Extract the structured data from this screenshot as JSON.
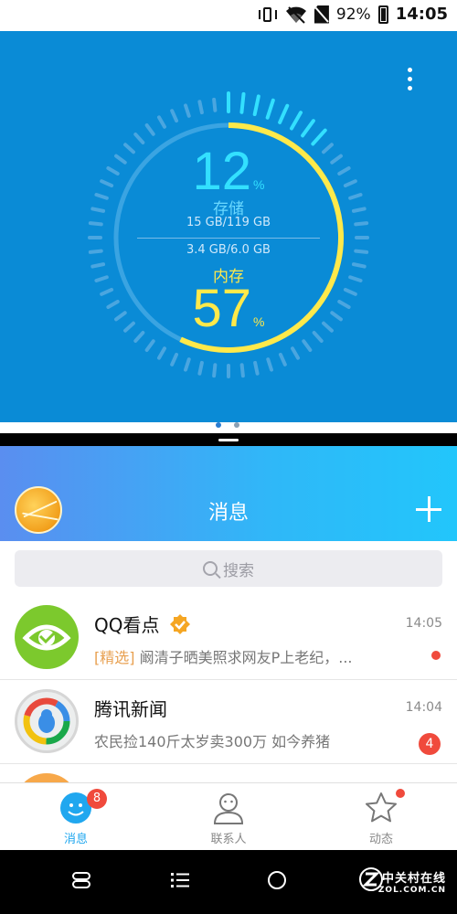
{
  "status_bar": {
    "battery": "92%",
    "time": "14:05",
    "icons": [
      "vibrate-icon",
      "wifi-icon",
      "no-sim-icon",
      "battery-icon"
    ]
  },
  "cleaner": {
    "storage_percent": "12",
    "storage_unit": "%",
    "storage_label": "存储",
    "storage_detail": "15 GB/119 GB",
    "memory_detail": "3.4 GB/6.0 GB",
    "memory_label": "内存",
    "memory_percent": "57",
    "memory_unit": "%",
    "colors": {
      "background": "#0a8bd6",
      "storage": "#33e0ff",
      "memory": "#ffe94a"
    }
  },
  "qq": {
    "header": {
      "title": "消息"
    },
    "search": {
      "placeholder": "搜索"
    },
    "conversations": [
      {
        "name": "QQ看点",
        "time": "14:05",
        "tag": "[精选]",
        "preview": " 阚清子晒美照求网友P上老纪，...",
        "unread": "dot",
        "avatar": "eye-icon"
      },
      {
        "name": "腾讯新闻",
        "time": "14:04",
        "preview": "农民捡140斤太岁卖300万 如今养猪",
        "unread": "4",
        "avatar": "tencent-news-icon"
      }
    ],
    "tabs": [
      {
        "label": "消息",
        "badge": "8",
        "active": true,
        "icon": "qq-penguin-icon"
      },
      {
        "label": "联系人",
        "active": false,
        "icon": "contacts-icon"
      },
      {
        "label": "动态",
        "active": false,
        "icon": "star-icon",
        "dot": true
      }
    ]
  },
  "watermark": {
    "line1": "中关村在线",
    "line2": "ZOL.COM.CN"
  }
}
